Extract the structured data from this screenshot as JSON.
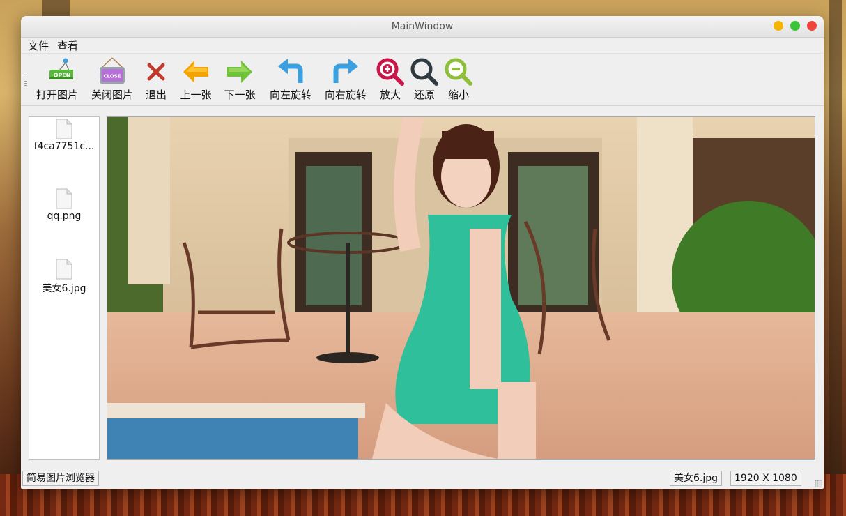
{
  "window": {
    "title": "MainWindow"
  },
  "menu": [
    {
      "label": "文件"
    },
    {
      "label": "查看"
    }
  ],
  "toolbar": [
    {
      "label": "打开图片",
      "icon": "open-sign-icon"
    },
    {
      "label": "关闭图片",
      "icon": "close-sign-icon"
    },
    {
      "label": "退出",
      "icon": "red-x-icon"
    },
    {
      "label": "上一张",
      "icon": "arrow-left-icon"
    },
    {
      "label": "下一张",
      "icon": "arrow-right-icon"
    },
    {
      "label": "向左旋转",
      "icon": "rotate-left-icon"
    },
    {
      "label": "向右旋转",
      "icon": "rotate-right-icon"
    },
    {
      "label": "放大",
      "icon": "zoom-in-icon"
    },
    {
      "label": "还原",
      "icon": "zoom-reset-icon"
    },
    {
      "label": "缩小",
      "icon": "zoom-out-icon"
    }
  ],
  "icon_text": {
    "open": "OPEN",
    "close": "CLOSE"
  },
  "files": [
    {
      "name": "f4ca7751c..."
    },
    {
      "name": "qq.png"
    },
    {
      "name": "美女6.jpg"
    }
  ],
  "status": {
    "app_name": "简易图片浏览器",
    "current_file": "美女6.jpg",
    "dimensions": "1920 X 1080"
  },
  "colors": {
    "accent_blue": "#3aa0e0",
    "zoom_in": "#c8184a",
    "zoom_out": "#8dbf3a",
    "arrow_yellow": "#f5a300",
    "arrow_green": "#6fc43a"
  }
}
